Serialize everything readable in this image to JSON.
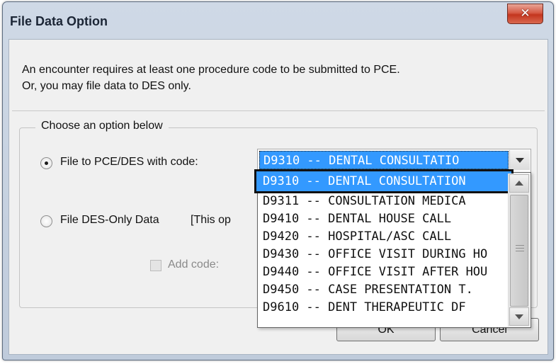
{
  "window": {
    "title": "File Data Option",
    "close_glyph": "✕"
  },
  "message": {
    "line1": "An encounter requires at least one procedure code to be submitted to PCE.",
    "line2": "Or, you may file data to DES only."
  },
  "group": {
    "legend": "Choose an option below",
    "option_pce_label": "File to PCE/DES with code:",
    "option_des_label": "File DES-Only Data",
    "option_des_note": "[This op",
    "add_code_label": "Add code:"
  },
  "combo": {
    "selected": "D9310 -- DENTAL CONSULTATIO"
  },
  "dropdown": {
    "items": [
      "D9310 -- DENTAL CONSULTATION",
      "D9311 -- CONSULTATION MEDICA",
      "D9410 -- DENTAL HOUSE CALL",
      "D9420 -- HOSPITAL/ASC CALL",
      "D9430 -- OFFICE VISIT DURING HO",
      "D9440 -- OFFICE VISIT AFTER HOU",
      "D9450 -- CASE PRESENTATION T.",
      "D9610 -- DENT THERAPEUTIC DF"
    ]
  },
  "buttons": {
    "ok": "OK",
    "cancel": "Cancel"
  },
  "colors": {
    "selection": "#3399ff",
    "close_button": "#c3351e",
    "dialog_bg": "#f0f0f0"
  },
  "icons": {
    "close": "close-icon",
    "dropdown_arrow": "chevron-down-icon",
    "scroll_up": "chevron-up-icon",
    "scroll_down": "chevron-down-icon"
  }
}
